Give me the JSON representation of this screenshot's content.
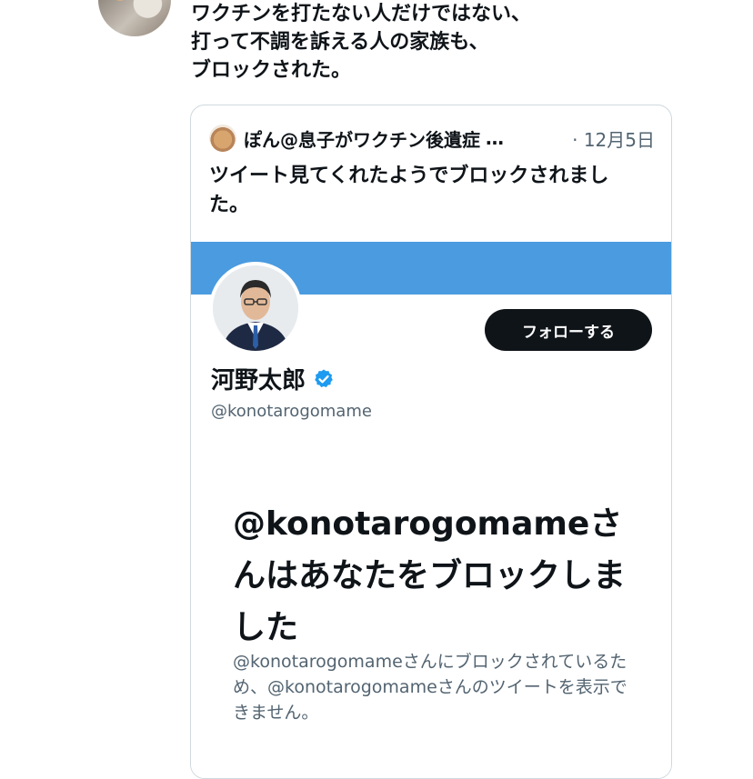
{
  "tweet": {
    "text": "ワクチンを打たない人だけではない、\n打って不調を訴える人の家族も、\nブロックされた。"
  },
  "quote": {
    "author_name": "ぽん@息子がワクチン後遺症",
    "ellipsis": "…",
    "date": "· 12月5日",
    "text": "ツイート見てくれたようでブロックされました。"
  },
  "profile_screenshot": {
    "follow_button_label": "フォローする",
    "display_name": "河野太郎",
    "handle": "@konotarogomame",
    "blocked_title": "@konotarogomameさんはあなたをブロックしました",
    "blocked_description": "@konotarogomameさんにブロックされているため、@konotarogomameさんのツイートを表示できません。"
  },
  "colors": {
    "banner": "#4a9be0",
    "verified_badge": "#1d9bf0",
    "follow_button_bg": "#0f1419",
    "secondary_text": "#536471"
  },
  "icons": {
    "verified": "verified-badge-icon"
  }
}
